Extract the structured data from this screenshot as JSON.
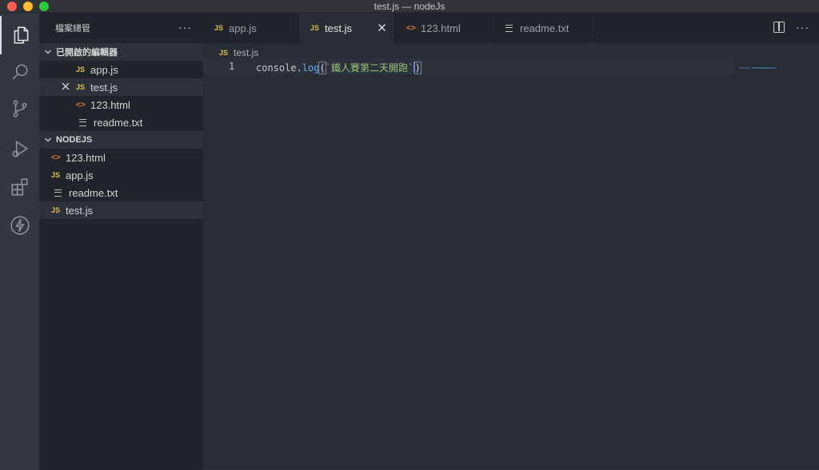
{
  "window": {
    "title": "test.js — nodeJs"
  },
  "activity_bar": {
    "items": [
      {
        "name": "explorer",
        "icon": "files-icon"
      },
      {
        "name": "search",
        "icon": "search-icon"
      },
      {
        "name": "source-control",
        "icon": "source-control-icon"
      },
      {
        "name": "run-debug",
        "icon": "debug-icon"
      },
      {
        "name": "extensions",
        "icon": "extensions-icon"
      },
      {
        "name": "lightning",
        "icon": "lightning-icon"
      }
    ]
  },
  "sidebar": {
    "title": "檔案總管",
    "more": "···",
    "open_editors": {
      "label": "已開啟的編輯器",
      "items": [
        {
          "badge": "JS",
          "label": "app.js"
        },
        {
          "badge": "JS",
          "label": "test.js"
        },
        {
          "badge": "<>",
          "label": "123.html"
        },
        {
          "badge": "≡",
          "label": "readme.txt"
        }
      ]
    },
    "folder": {
      "label": "NODEJS",
      "items": [
        {
          "badge": "<>",
          "label": "123.html"
        },
        {
          "badge": "JS",
          "label": "app.js"
        },
        {
          "badge": "≡",
          "label": "readme.txt"
        },
        {
          "badge": "JS",
          "label": "test.js"
        }
      ]
    }
  },
  "tabs": [
    {
      "badge": "JS",
      "label": "app.js"
    },
    {
      "badge": "JS",
      "label": "test.js"
    },
    {
      "badge": "<>",
      "label": "123.html"
    },
    {
      "badge": "≡",
      "label": "readme.txt"
    }
  ],
  "tab_actions": {
    "more": "···"
  },
  "editor": {
    "breadcrumb": {
      "badge": "JS",
      "label": "test.js"
    },
    "line_number": "1",
    "code": {
      "object": "console.",
      "method": "log",
      "open_paren": "(",
      "string": "`鐵人賽第二天開跑`",
      "close_paren": ")"
    }
  },
  "colors": {
    "js_badge": "#d8c14a",
    "html_badge": "#e37933",
    "string": "#98c379",
    "method": "#61afef"
  }
}
